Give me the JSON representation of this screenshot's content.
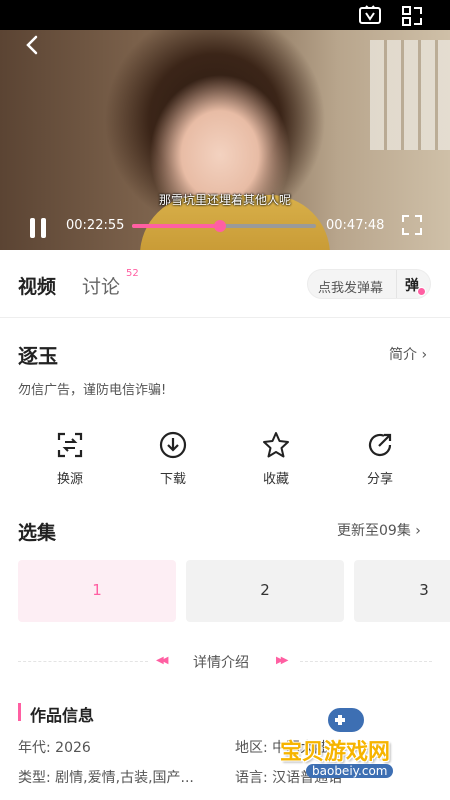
{
  "player": {
    "subtitle": "那雪坑里还埋着其他人呢",
    "current_time": "00:22:55",
    "total_time": "00:47:48",
    "progress": 0.48
  },
  "tabs": {
    "video": "视频",
    "discuss": "讨论",
    "discuss_count": "52",
    "danmaku_placeholder": "点我发弹幕",
    "danmaku_button": "弹"
  },
  "show": {
    "title": "逐玉",
    "intro_link": "简介 ›",
    "notice": "勿信广告，谨防电信诈骗!"
  },
  "actions": [
    {
      "label": "换源",
      "icon": "switch-source-icon"
    },
    {
      "label": "下载",
      "icon": "download-icon"
    },
    {
      "label": "收藏",
      "icon": "star-icon"
    },
    {
      "label": "分享",
      "icon": "share-icon"
    }
  ],
  "episodes": {
    "title": "选集",
    "update": "更新至09集 ›",
    "items": [
      "1",
      "2",
      "3"
    ]
  },
  "detail": {
    "title": "详情介绍"
  },
  "work_info": {
    "title": "作品信息",
    "year": "年代: 2026",
    "region": "地区: 中国大陆",
    "genre": "类型: 剧情,爱情,古装,国产...",
    "language": "语言: 汉语普通话"
  },
  "watermark": {
    "text": "宝贝游戏网",
    "url": "baobeiy.com"
  },
  "colors": {
    "accent": "#ff5fa2"
  }
}
